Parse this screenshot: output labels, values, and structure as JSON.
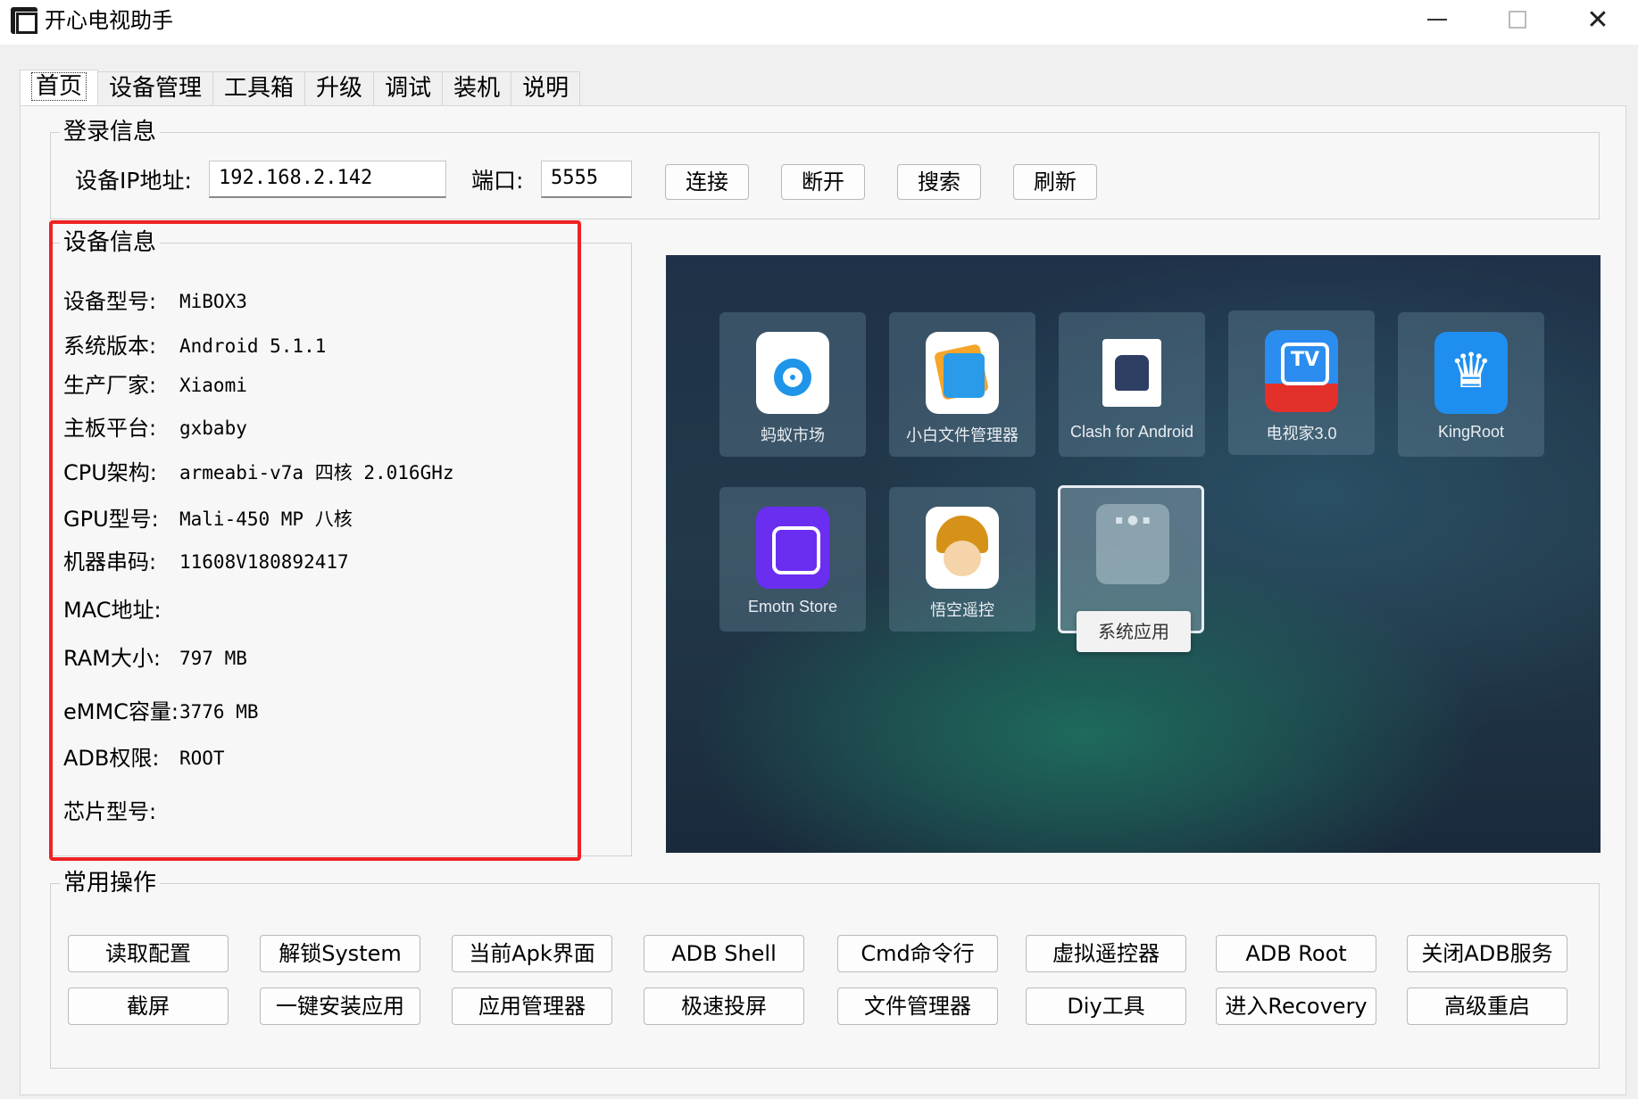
{
  "window": {
    "title": "开心电视助手",
    "close_glyph": "✕"
  },
  "tabs": [
    "首页",
    "设备管理",
    "工具箱",
    "升级",
    "调试",
    "装机",
    "说明"
  ],
  "login": {
    "group_title": "登录信息",
    "ip_label": "设备IP地址:",
    "ip_value": "192.168.2.142",
    "port_label": "端口:",
    "port_value": "5555",
    "buttons": [
      "连接",
      "断开",
      "搜索",
      "刷新"
    ]
  },
  "device": {
    "group_title": "设备信息",
    "rows": [
      {
        "key": "设备型号:",
        "value": "MiBOX3"
      },
      {
        "key": "系统版本:",
        "value": "Android 5.1.1"
      },
      {
        "key": "生产厂家:",
        "value": "Xiaomi"
      },
      {
        "key": "主板平台:",
        "value": "gxbaby"
      },
      {
        "key": "CPU架构:",
        "value": "armeabi-v7a 四核 2.016GHz"
      },
      {
        "key": "GPU型号:",
        "value": "Mali-450 MP 八核"
      },
      {
        "key": "机器串码:",
        "value": "11608V180892417"
      },
      {
        "key": "MAC地址:",
        "value": ""
      },
      {
        "key": "RAM大小:",
        "value": "797 MB"
      },
      {
        "key": "eMMC容量:",
        "value": "3776 MB"
      },
      {
        "key": "ADB权限:",
        "value": "ROOT"
      },
      {
        "key": "芯片型号:",
        "value": ""
      }
    ]
  },
  "tv_screen": {
    "apps": [
      {
        "label": "蚂蚁市场",
        "icon": "ant-market-icon"
      },
      {
        "label": "小白文件管理器",
        "icon": "file-manager-icon"
      },
      {
        "label": "Clash for Android",
        "icon": "clash-cat-icon"
      },
      {
        "label": "电视家3.0",
        "icon": "tv-home-icon"
      },
      {
        "label": "KingRoot",
        "icon": "crown-icon"
      },
      {
        "label": "Emotn Store",
        "icon": "emotn-store-icon"
      },
      {
        "label": "悟空遥控",
        "icon": "wukong-remote-icon"
      },
      {
        "label": "系统应用",
        "icon": "system-apps-folder-icon"
      }
    ]
  },
  "ops": {
    "group_title": "常用操作",
    "buttons": [
      "读取配置",
      "解锁System",
      "当前Apk界面",
      "ADB Shell",
      "Cmd命令行",
      "虚拟遥控器",
      "ADB  Root",
      "关闭ADB服务",
      "截屏",
      "一键安装应用",
      "应用管理器",
      "极速投屏",
      "文件管理器",
      "Diy工具",
      "进入Recovery",
      "高级重启"
    ]
  },
  "colors": {
    "highlight": "#ee2222",
    "window_bg": "#f0f0f0"
  }
}
